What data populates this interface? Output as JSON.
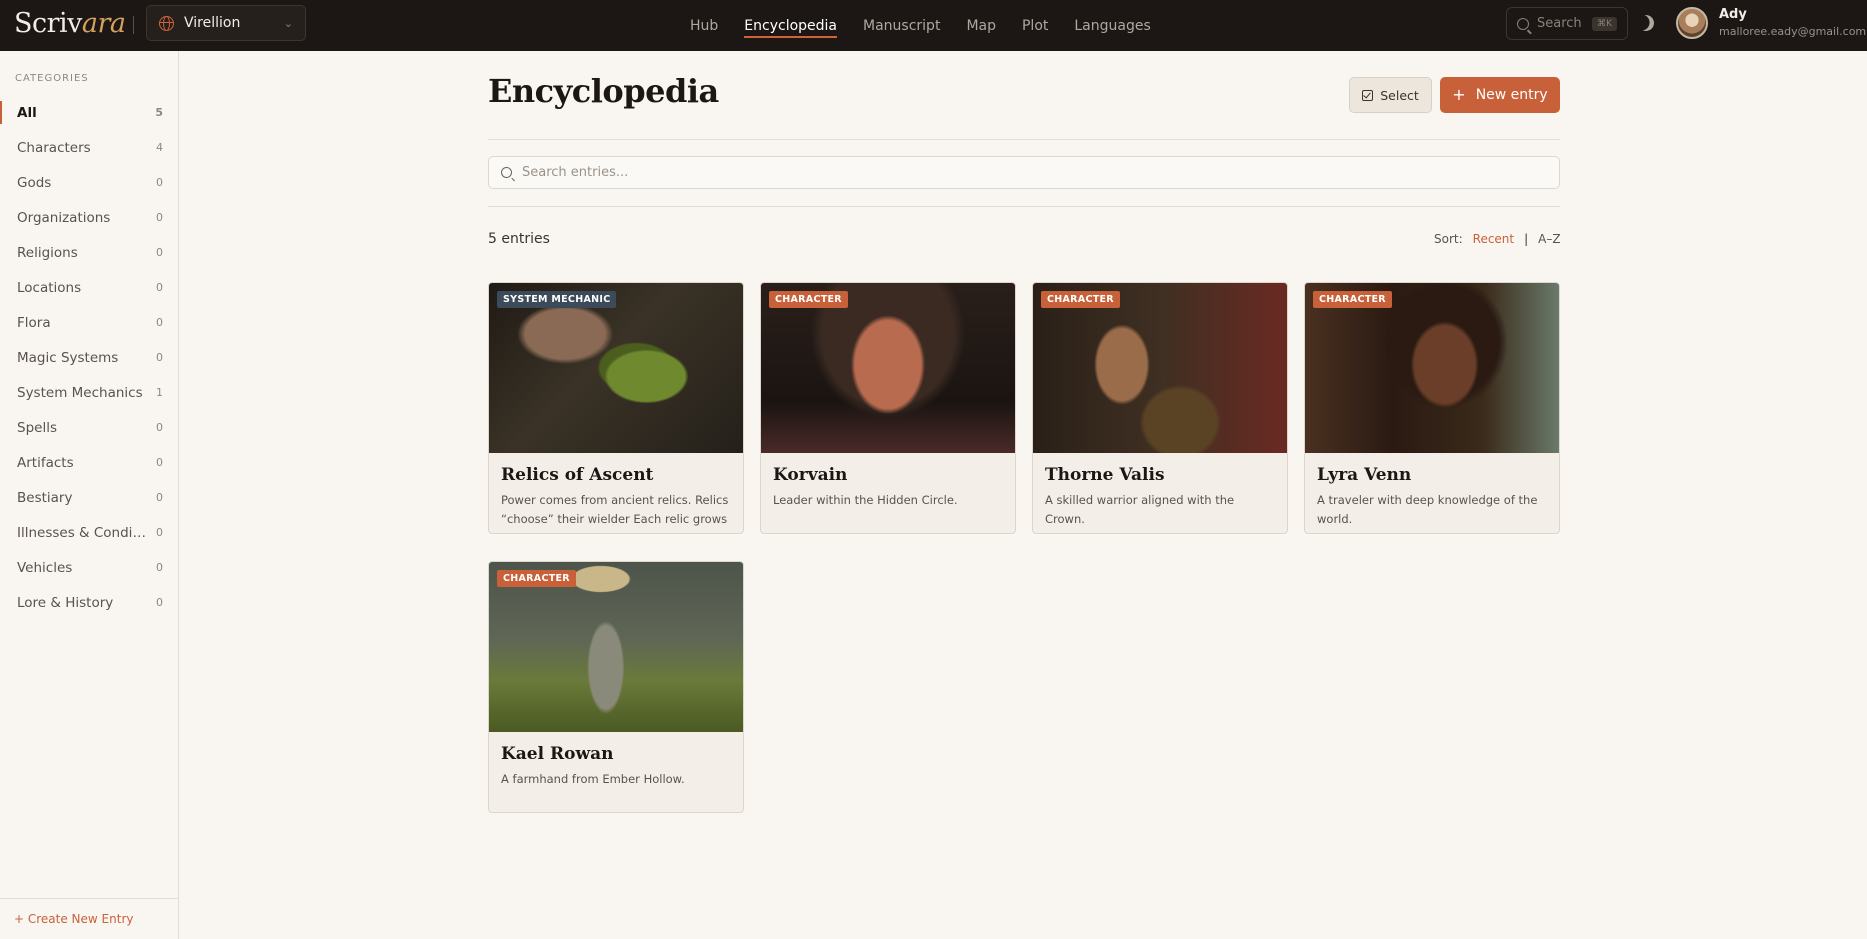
{
  "app": {
    "logo_main": "Scriv",
    "logo_italic": "ara",
    "project": "Virellion"
  },
  "nav": {
    "items": [
      {
        "label": "Hub"
      },
      {
        "label": "Encyclopedia",
        "active": true
      },
      {
        "label": "Manuscript"
      },
      {
        "label": "Map"
      },
      {
        "label": "Plot"
      },
      {
        "label": "Languages"
      }
    ]
  },
  "header_search": {
    "label": "Search",
    "shortcut": "⌘K"
  },
  "user": {
    "name": "Ady",
    "email": "malloree.eady@gmail.com"
  },
  "sidebar": {
    "heading": "CATEGORIES",
    "items": [
      {
        "label": "All",
        "count": "5",
        "active": true
      },
      {
        "label": "Characters",
        "count": "4"
      },
      {
        "label": "Gods",
        "count": "0"
      },
      {
        "label": "Organizations",
        "count": "0"
      },
      {
        "label": "Religions",
        "count": "0"
      },
      {
        "label": "Locations",
        "count": "0"
      },
      {
        "label": "Flora",
        "count": "0"
      },
      {
        "label": "Magic Systems",
        "count": "0"
      },
      {
        "label": "System Mechanics",
        "count": "1"
      },
      {
        "label": "Spells",
        "count": "0"
      },
      {
        "label": "Artifacts",
        "count": "0"
      },
      {
        "label": "Bestiary",
        "count": "0"
      },
      {
        "label": "Illnesses & Conditions",
        "count": "0"
      },
      {
        "label": "Vehicles",
        "count": "0"
      },
      {
        "label": "Lore & History",
        "count": "0"
      }
    ],
    "footer": "+ Create New Entry"
  },
  "main": {
    "title": "Encyclopedia",
    "select_label": "Select",
    "new_entry_label": "New entry",
    "search_placeholder": "Search entries...",
    "entry_count": "5 entries",
    "sort_label": "Sort:",
    "sort_recent": "Recent",
    "sort_az": "A–Z"
  },
  "entries": [
    {
      "badge": "SYSTEM MECHANIC",
      "title": "Relics of Ascent",
      "desc": "Power comes from ancient relics. Relics “choose” their wielder Each relic grows in power with its bearer"
    },
    {
      "badge": "CHARACTER",
      "title": "Korvain",
      "desc": "Leader within the Hidden Circle."
    },
    {
      "badge": "CHARACTER",
      "title": "Thorne Valis",
      "desc": "A skilled warrior aligned with the Crown."
    },
    {
      "badge": "CHARACTER",
      "title": "Lyra Venn",
      "desc": "A traveler with deep knowledge of the world."
    },
    {
      "badge": "CHARACTER",
      "title": "Kael Rowan",
      "desc": "A farmhand from Ember Hollow."
    }
  ],
  "colors": {
    "accent": "#c8613a",
    "topbar": "#1c1714",
    "background": "#f9f6f1",
    "mechanic_badge": "#3d4a5a"
  }
}
